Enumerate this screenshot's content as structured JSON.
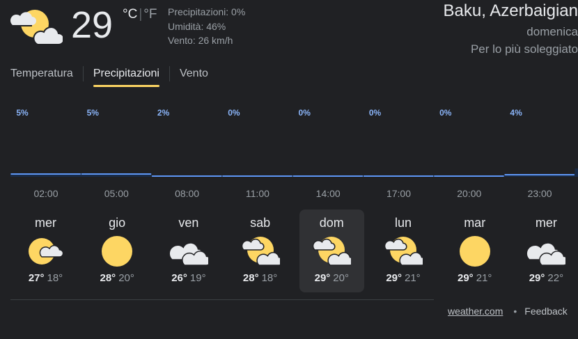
{
  "current": {
    "temp": "29",
    "unit_c": "°C",
    "unit_f": "°F",
    "icon": "sunny-partly-cloudy-icon",
    "precip": "Precipitazioni: 0%",
    "humidity": "Umidità: 46%",
    "wind": "Vento: 26 km/h"
  },
  "location": {
    "name": "Baku, Azerbaigian",
    "day": "domenica",
    "condition": "Per lo più soleggiato"
  },
  "tabs": [
    {
      "label": "Temperatura",
      "active": false
    },
    {
      "label": "Precipitazioni",
      "active": true
    },
    {
      "label": "Vento",
      "active": false
    }
  ],
  "chart_data": {
    "type": "bar",
    "categories": [
      "02:00",
      "05:00",
      "08:00",
      "11:00",
      "14:00",
      "17:00",
      "20:00",
      "23:00"
    ],
    "values": [
      5,
      5,
      2,
      0,
      0,
      0,
      0,
      4
    ],
    "value_labels": [
      "5%",
      "5%",
      "2%",
      "0%",
      "0%",
      "0%",
      "0%",
      "4%"
    ],
    "ylim": [
      0,
      100
    ],
    "bar_color": "#5e97f6",
    "label_color": "#8ab4f8"
  },
  "days": [
    {
      "name": "mer",
      "icon": "partly-cloudy-icon",
      "hi": "27°",
      "lo": "18°",
      "selected": false
    },
    {
      "name": "gio",
      "icon": "sunny-icon",
      "hi": "28°",
      "lo": "20°",
      "selected": false
    },
    {
      "name": "ven",
      "icon": "cloudy-icon",
      "hi": "26°",
      "lo": "19°",
      "selected": false
    },
    {
      "name": "sab",
      "icon": "mostly-sunny-icon",
      "hi": "28°",
      "lo": "18°",
      "selected": false
    },
    {
      "name": "dom",
      "icon": "mostly-sunny-icon",
      "hi": "29°",
      "lo": "20°",
      "selected": true
    },
    {
      "name": "lun",
      "icon": "mostly-sunny-icon",
      "hi": "29°",
      "lo": "21°",
      "selected": false
    },
    {
      "name": "mar",
      "icon": "sunny-icon",
      "hi": "29°",
      "lo": "21°",
      "selected": false
    },
    {
      "name": "mer",
      "icon": "cloudy-icon",
      "hi": "29°",
      "lo": "22°",
      "selected": false
    }
  ],
  "footer": {
    "source": "weather.com",
    "separator": "•",
    "feedback": "Feedback"
  }
}
